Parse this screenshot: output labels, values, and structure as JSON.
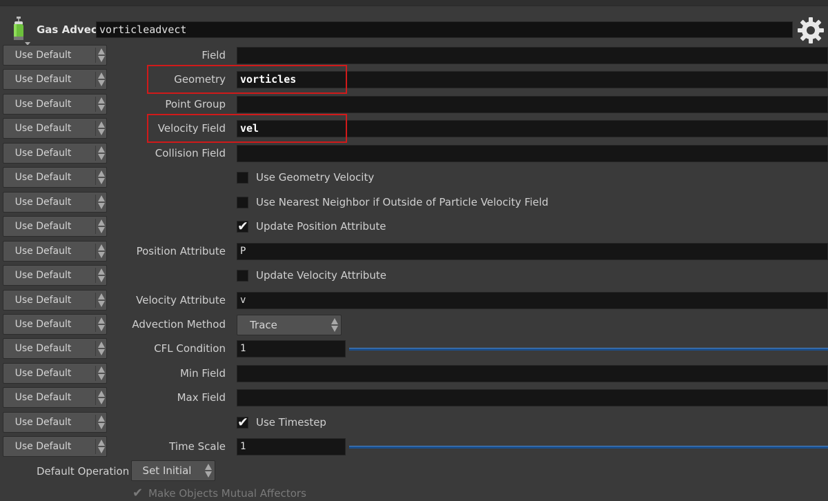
{
  "header": {
    "node_type": "Gas Advect",
    "node_name": "vorticleadvect"
  },
  "use_default_label": "Use Default",
  "params": [
    {
      "kind": "field",
      "label": "Field",
      "value": ""
    },
    {
      "kind": "field",
      "label": "Geometry",
      "value": "vorticles",
      "bold": true,
      "highlighted": true
    },
    {
      "kind": "field",
      "label": "Point Group",
      "value": ""
    },
    {
      "kind": "field",
      "label": "Velocity Field",
      "value": "vel",
      "bold": true,
      "highlighted": true
    },
    {
      "kind": "field",
      "label": "Collision Field",
      "value": ""
    },
    {
      "kind": "checkbox",
      "label": "Use Geometry Velocity",
      "checked": false
    },
    {
      "kind": "checkbox",
      "label": "Use Nearest Neighbor if Outside of Particle Velocity Field",
      "checked": false
    },
    {
      "kind": "checkbox",
      "label": "Update Position Attribute",
      "checked": true
    },
    {
      "kind": "field",
      "label": "Position Attribute",
      "value": "P"
    },
    {
      "kind": "checkbox",
      "label": "Update Velocity Attribute",
      "checked": false
    },
    {
      "kind": "field",
      "label": "Velocity Attribute",
      "value": "v"
    },
    {
      "kind": "menu",
      "label": "Advection Method",
      "value": "Trace"
    },
    {
      "kind": "slider",
      "label": "CFL Condition",
      "value": "1"
    },
    {
      "kind": "field",
      "label": "Min Field",
      "value": ""
    },
    {
      "kind": "field",
      "label": "Max Field",
      "value": ""
    },
    {
      "kind": "checkbox",
      "label": "Use Timestep",
      "checked": true
    },
    {
      "kind": "slider",
      "label": "Time Scale",
      "value": "1"
    }
  ],
  "default_operation": {
    "label": "Default Operation",
    "value": "Set Initial"
  },
  "mutual_affectors": {
    "label": "Make Objects Mutual Affectors",
    "checked": true,
    "disabled": true
  },
  "colors": {
    "highlight": "#d11a1a",
    "slider": "#1b4f8c"
  }
}
